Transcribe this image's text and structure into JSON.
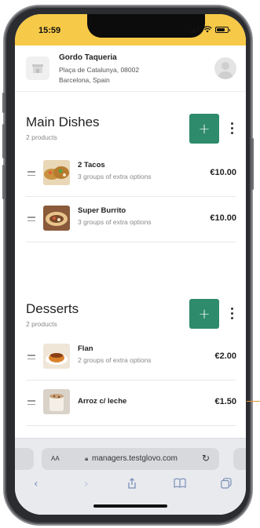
{
  "status": {
    "time": "15:59"
  },
  "header": {
    "store_name": "Gordo Taqueria",
    "address_line1": "Plaça de Catalunya, 08002",
    "address_line2": "Barcelona, Spain"
  },
  "sections": [
    {
      "title": "Main Dishes",
      "count": "2 products",
      "add_label": "+",
      "items": [
        {
          "name": "2 Tacos",
          "sub": "3 groups of extra options",
          "price": "€10.00"
        },
        {
          "name": "Super Burrito",
          "sub": "3 groups of extra options",
          "price": "€10.00"
        }
      ]
    },
    {
      "title": "Desserts",
      "count": "2 products",
      "add_label": "+",
      "items": [
        {
          "name": "Flan",
          "sub": "2 groups of extra options",
          "price": "€2.00"
        },
        {
          "name": "Arroz c/ leche",
          "sub": "",
          "price": "€1.50"
        }
      ]
    }
  ],
  "browser": {
    "aa_label": "AA",
    "url": "managers.testglovo.com",
    "lock_icon": "lock-icon",
    "reload_icon": "reload-icon",
    "icons": [
      "back-icon",
      "forward-icon",
      "share-icon",
      "bookmarks-icon",
      "tabs-icon"
    ]
  },
  "colors": {
    "status_bar": "#f7c948",
    "accent": "#2e8b6b"
  }
}
